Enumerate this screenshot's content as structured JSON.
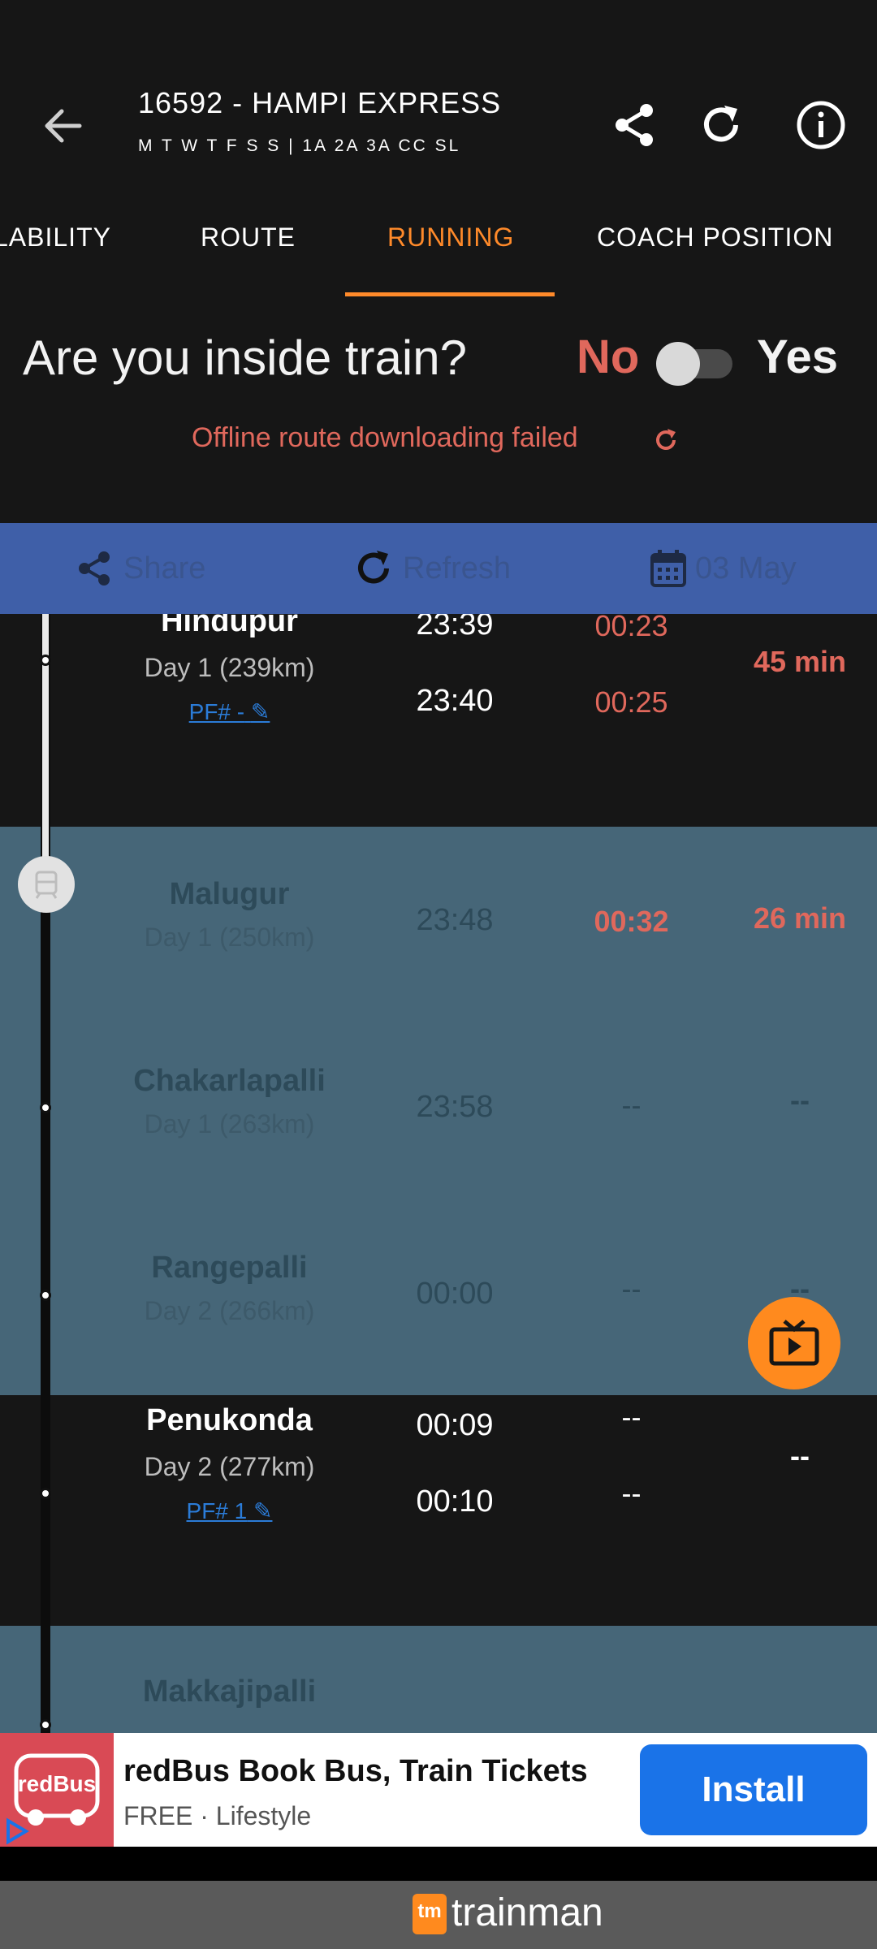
{
  "header": {
    "title": "16592 - HAMPI EXPRESS",
    "subtitle": "M T W T F S S  |  1A 2A 3A CC SL"
  },
  "tabs": [
    {
      "label": "LABILITY"
    },
    {
      "label": "ROUTE"
    },
    {
      "label": "RUNNING",
      "active": true
    },
    {
      "label": "COACH POSITION"
    }
  ],
  "inside_train": {
    "question": "Are you inside train?",
    "no_label": "No",
    "yes_label": "Yes",
    "toggle_on": false
  },
  "offline_message": "Offline route downloading failed",
  "actions": {
    "share": "Share",
    "refresh": "Refresh",
    "date": "03 May"
  },
  "stations": [
    {
      "name": "Hindupur",
      "day": "Day 1 (239km)",
      "pf": "PF# -",
      "sch_arr": "23:39",
      "sch_dep": "23:40",
      "act_arr": "00:23",
      "act_dep": "00:25",
      "delay": "45 min"
    },
    {
      "name": "Malugur",
      "day": "Day 1 (250km)",
      "sch": "23:48",
      "act": "00:32",
      "delay": "26 min"
    },
    {
      "name": "Chakarlapalli",
      "day": "Day 1 (263km)",
      "sch": "23:58",
      "act": "--",
      "delay": "--"
    },
    {
      "name": "Rangepalli",
      "day": "Day 2 (266km)",
      "sch": "00:00",
      "act": "--",
      "delay": "--"
    },
    {
      "name": "Penukonda",
      "day": "Day 2 (277km)",
      "pf": "PF# 1",
      "sch_arr": "00:09",
      "sch_dep": "00:10",
      "act_arr": "--",
      "act_dep": "--",
      "delay": "--"
    },
    {
      "name": "Makkajipalli"
    }
  ],
  "ad": {
    "title": "redBus Book Bus, Train Tickets",
    "subtitle": "FREE · Lifestyle",
    "install": "Install",
    "logo_text": "redBus"
  },
  "footer": {
    "brand": "trainman",
    "logo_text": "tm"
  },
  "colors": {
    "accent": "#ff8a2a",
    "delay": "#e0685c",
    "action_bar": "#3f5fa8",
    "stoppage_row": "#466678"
  }
}
